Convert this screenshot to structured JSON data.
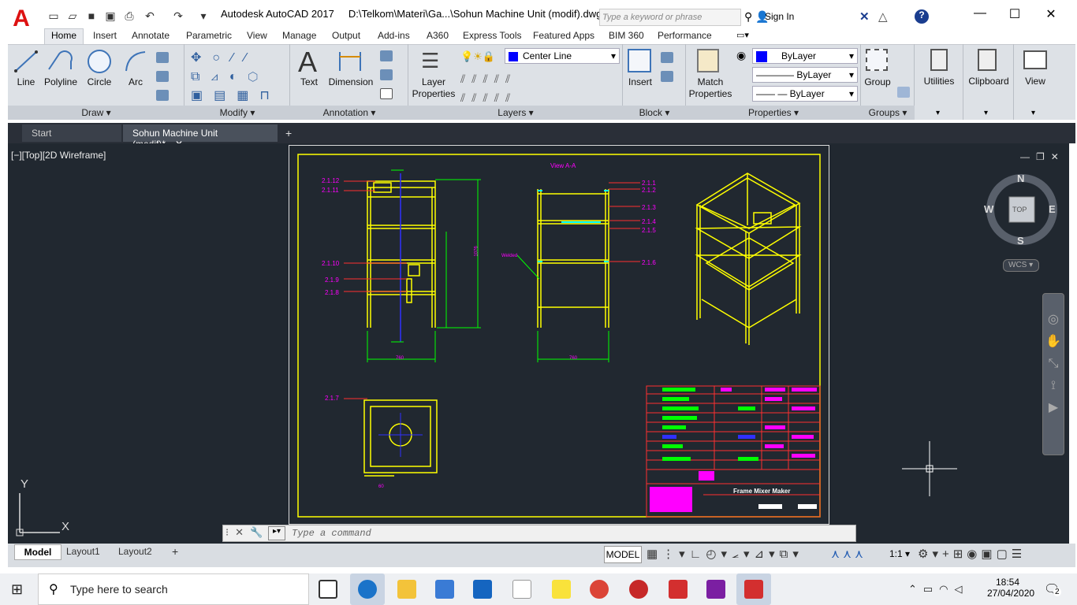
{
  "app": {
    "title": "Autodesk AutoCAD 2017",
    "file_path": "D:\\Telkom\\Materi\\Ga...\\Sohun Machine Unit (modif).dwg",
    "app_letter": "A",
    "search_placeholder": "Type a keyword or phrase",
    "sign_in": "Sign In",
    "help": "?"
  },
  "ribbon_tabs": [
    "Home",
    "Insert",
    "Annotate",
    "Parametric",
    "View",
    "Manage",
    "Output",
    "Add-ins",
    "A360",
    "Express Tools",
    "Featured Apps",
    "BIM 360",
    "Performance"
  ],
  "draw_panel": {
    "label": "Draw",
    "tools": [
      "Line",
      "Polyline",
      "Circle",
      "Arc"
    ]
  },
  "modify_panel": {
    "label": "Modify"
  },
  "annotation_panel": {
    "label": "Annotation",
    "tools": [
      "Text",
      "Dimension"
    ]
  },
  "layers_panel": {
    "label": "Layers",
    "tool": "Layer Properties",
    "current_layer": "Center Line"
  },
  "block_panel": {
    "label": "Block",
    "tool": "Insert"
  },
  "properties_panel": {
    "label": "Properties",
    "tool": "Match Properties",
    "color": "ByLayer",
    "linetype": "ByLayer",
    "lineweight": "ByLayer"
  },
  "groups_panel": {
    "label": "Groups",
    "tool": "Group"
  },
  "other_tools": [
    "Utilities",
    "Clipboard",
    "View"
  ],
  "doc_tabs": {
    "start": "Start",
    "active": "Sohun Machine Unit (modif)*",
    "add": "+"
  },
  "viewport_label": "[−][Top][2D Wireframe]",
  "viewcube": {
    "n": "N",
    "s": "S",
    "e": "E",
    "w": "W",
    "face": "TOP",
    "wcs": "WCS"
  },
  "ucs": {
    "x": "X",
    "y": "Y"
  },
  "drawing": {
    "view_title": "View A-A",
    "labels_left": [
      "2.1.12",
      "2.1.11",
      "2.1.10",
      "2.1.9",
      "2.1.8",
      "2.1.7"
    ],
    "labels_right": [
      "2.1.1",
      "2.1.2",
      "2.1.3",
      "2.1.4",
      "2.1.5",
      "2.1.6"
    ],
    "welded": "Welded",
    "dims": [
      "760",
      "760",
      "1076",
      "60"
    ],
    "title_block": "Frame Mixer Maker"
  },
  "command_placeholder": "Type a command",
  "layout_tabs": [
    "Model",
    "Layout1",
    "Layout2"
  ],
  "status": {
    "model": "MODEL",
    "scale": "1:1"
  },
  "taskbar": {
    "search": "Type here to search",
    "time": "18:54",
    "date": "27/04/2020",
    "notif": "2"
  },
  "colors": {
    "canvas": "#212830",
    "yellow": "#ffff00",
    "magenta": "#ff00ff",
    "cyan": "#00ffff",
    "green": "#00ff00",
    "ribbon": "#dde1e6"
  }
}
